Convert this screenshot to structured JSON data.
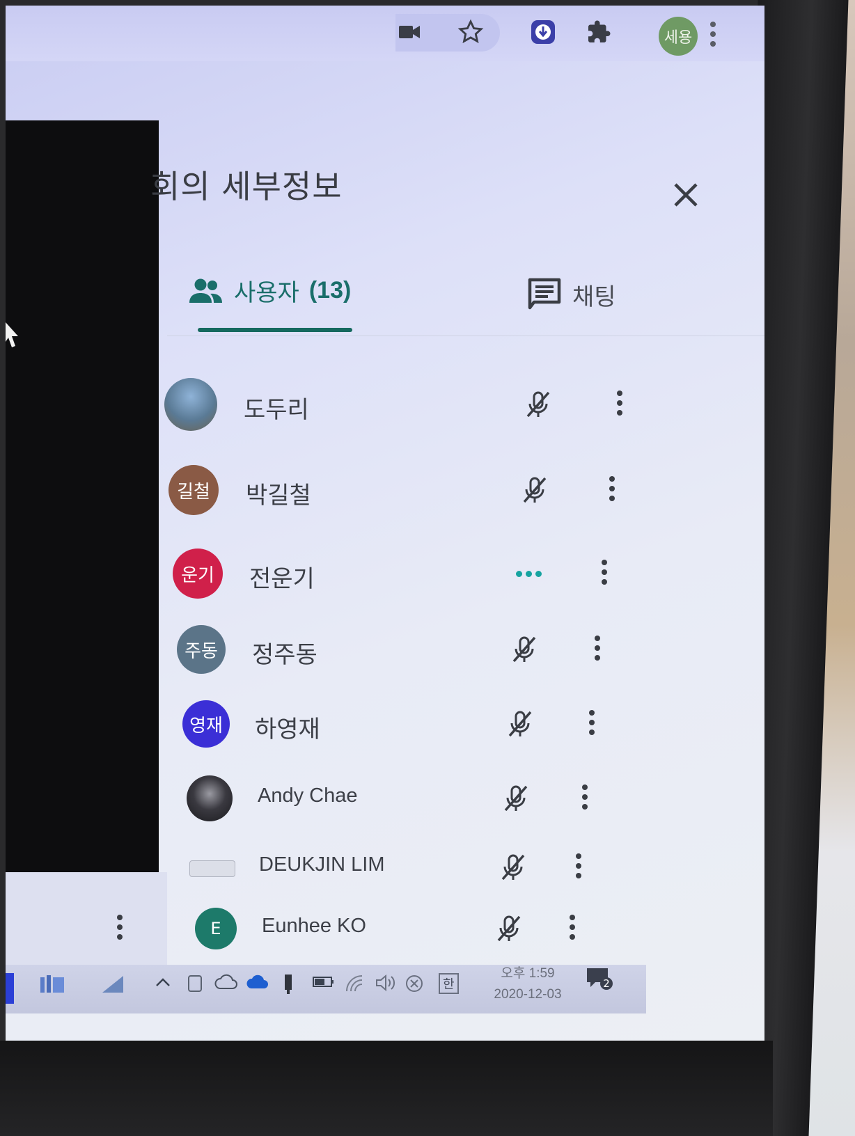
{
  "browser": {
    "profile_label": "세용",
    "icons": [
      "camera-icon",
      "star-icon",
      "extension-app-icon",
      "puzzle-icon",
      "profile-avatar",
      "more-vert-icon"
    ]
  },
  "panel": {
    "title": "회의 세부정보",
    "tabs": {
      "users_label": "사용자",
      "users_count": "(13)",
      "chat_label": "채팅"
    }
  },
  "participants": [
    {
      "name": "도두리",
      "avatar_text": "",
      "avatar_color": "#5a7a95",
      "mic": "muted"
    },
    {
      "name": "박길철",
      "avatar_text": "길철",
      "avatar_color": "#8a5a45",
      "mic": "muted"
    },
    {
      "name": "전운기",
      "avatar_text": "운기",
      "avatar_color": "#d0204a",
      "mic": "speaking"
    },
    {
      "name": "정주동",
      "avatar_text": "주동",
      "avatar_color": "#5b7488",
      "mic": "muted"
    },
    {
      "name": "하영재",
      "avatar_text": "영재",
      "avatar_color": "#3b2fd6",
      "mic": "muted"
    },
    {
      "name": "Andy Chae",
      "avatar_text": "",
      "avatar_color": "#2b2a30",
      "mic": "muted"
    },
    {
      "name": "DEUKJIN LIM",
      "avatar_text": "",
      "avatar_color": "#e9ebf2",
      "mic": "muted"
    },
    {
      "name": "Eunhee KO",
      "avatar_text": "E",
      "avatar_color": "#1d7a6a",
      "mic": "muted"
    }
  ],
  "taskbar": {
    "ime_label": "한",
    "time": "오후 1:59",
    "date": "2020-12-03",
    "notification_count": "2"
  }
}
